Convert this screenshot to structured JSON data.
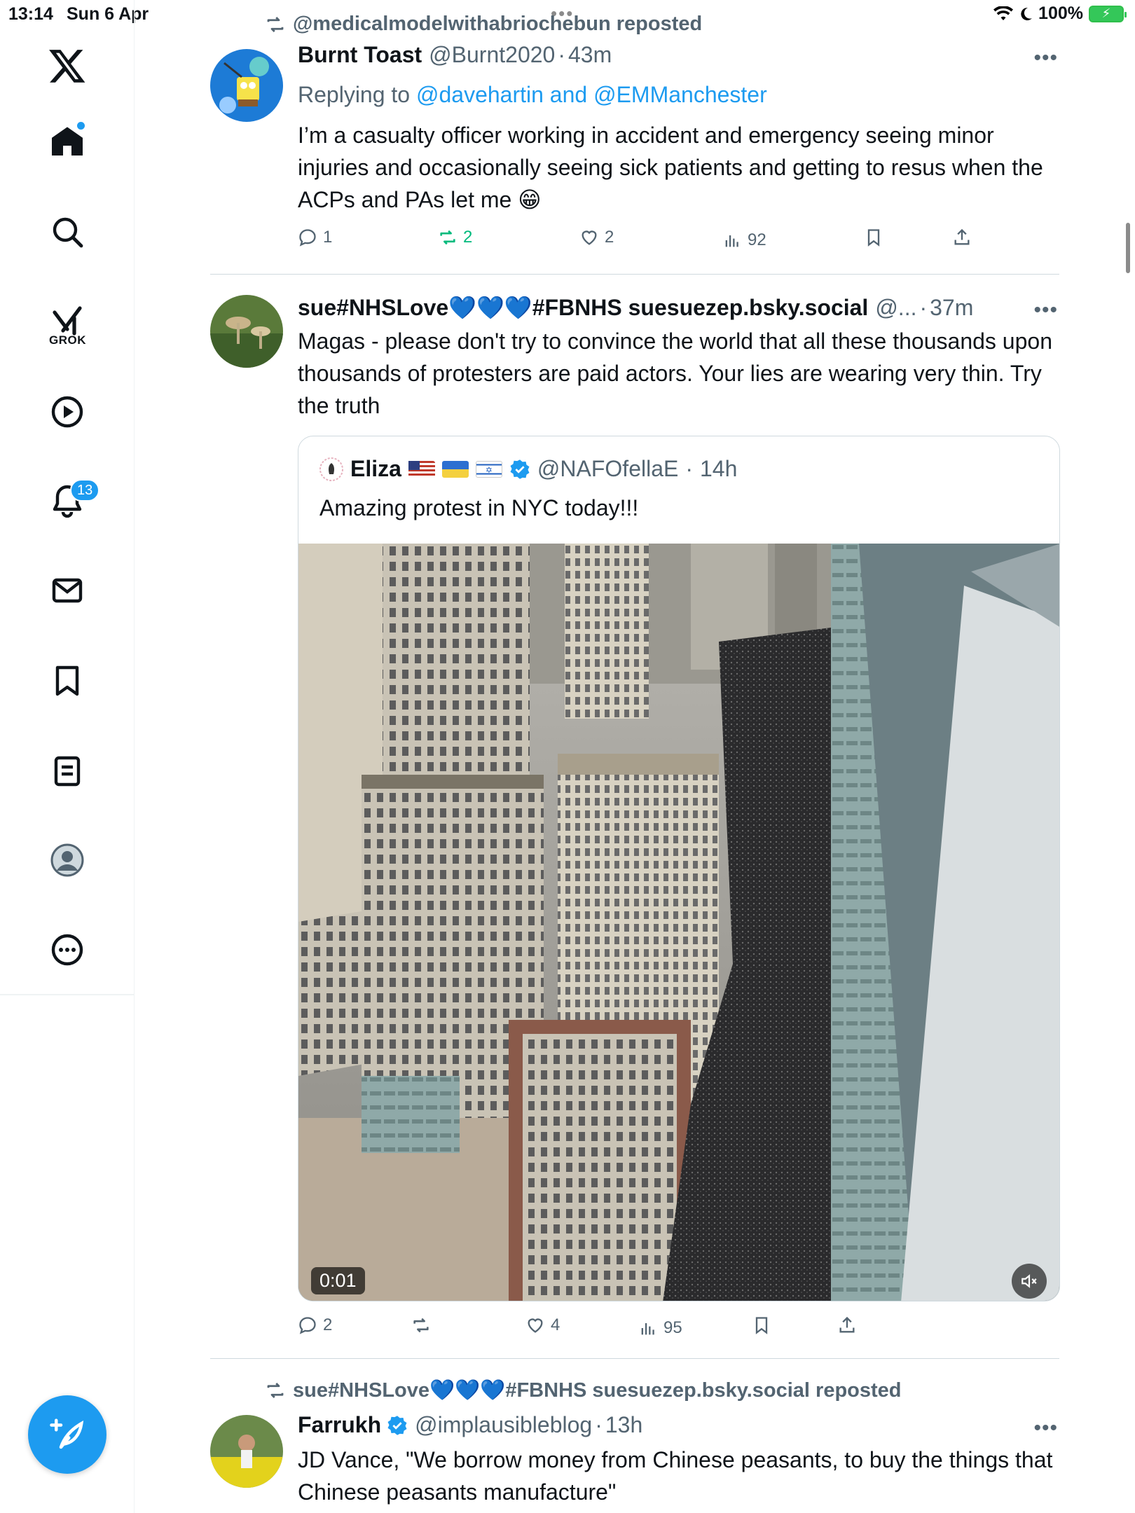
{
  "status_bar": {
    "time": "13:14",
    "date": "Sun 6 Apr",
    "battery": "100%"
  },
  "sidebar": {
    "items": [
      {
        "name": "home",
        "icon": "home-icon"
      },
      {
        "name": "explore",
        "icon": "search-icon"
      },
      {
        "name": "grok",
        "icon": "grok-icon",
        "label": "GROK"
      },
      {
        "name": "videos",
        "icon": "play-icon"
      },
      {
        "name": "notifications",
        "icon": "bell-icon",
        "badge": "13"
      },
      {
        "name": "messages",
        "icon": "mail-icon"
      },
      {
        "name": "bookmarks",
        "icon": "bookmark-icon"
      },
      {
        "name": "lists",
        "icon": "list-icon"
      },
      {
        "name": "profile",
        "icon": "profile-icon"
      },
      {
        "name": "more",
        "icon": "more-icon"
      }
    ],
    "compose_icon": "compose-icon"
  },
  "feed": {
    "tweets": [
      {
        "repost_by": "@medicalmodelwithabriochebun reposted",
        "name": "Burnt Toast",
        "handle": "@Burnt2020",
        "time": "43m",
        "replying_prefix": "Replying to",
        "replying_to": "@davehartin and @EMManchester",
        "text": "I’m a casualty officer working in accident and emergency seeing minor injuries and occasionally seeing sick patients and getting to resus when the ACPs and PAs let me 😁",
        "replies": "1",
        "reposts": "2",
        "likes": "2",
        "views": "92"
      },
      {
        "name": "sue#NHSLove💙💙💙#FBNHS suesuezep.bsky.social",
        "handle": "@...",
        "time": "37m",
        "text": "Magas - please don't try to convince the world that all these thousands upon thousands of protesters are paid actors. Your lies are wearing very thin. Try the truth",
        "quote": {
          "name": "Eliza",
          "handle": "@NAFOfellaE",
          "time": "14h",
          "text": "Amazing protest in NYC today!!!",
          "video_time": "0:01"
        },
        "replies": "2",
        "reposts": "",
        "likes": "4",
        "views": "95"
      },
      {
        "repost_by": "sue#NHSLove💙💙💙#FBNHS suesuezep.bsky.social reposted",
        "name": "Farrukh",
        "handle": "@implausibleblog",
        "time": "13h",
        "text": "JD Vance, \"We borrow money from Chinese peasants, to buy the things that Chinese peasants manufacture\""
      }
    ]
  },
  "colors": {
    "accent": "#1d9bf0",
    "text": "#0f1419",
    "muted": "#536471",
    "repost_green": "#00ba7c",
    "border": "#cfd9de"
  }
}
